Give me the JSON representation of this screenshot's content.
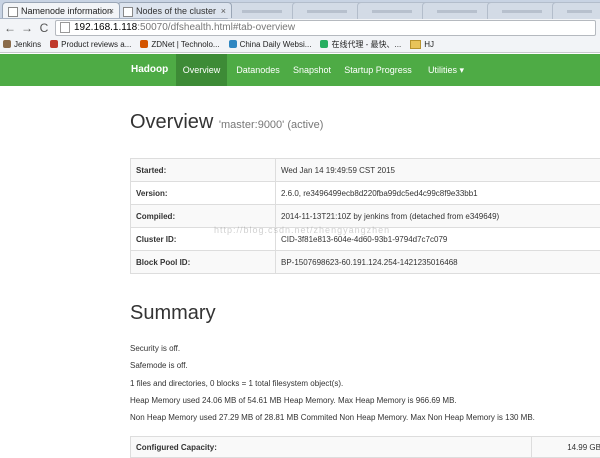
{
  "browser": {
    "tabs": [
      {
        "title": "Namenode information",
        "close": "×"
      },
      {
        "title": "Nodes of the cluster",
        "close": "×"
      }
    ],
    "url": {
      "host": "192.168.1.118",
      "rest": ":50070/dfshealth.html#tab-overview"
    },
    "nav": {
      "back": "←",
      "forward": "→",
      "reload": "C"
    },
    "bookmarks": [
      {
        "label": "Jenkins",
        "color": "#8a6b4a"
      },
      {
        "label": "Product reviews a...",
        "color": "#c0392b"
      },
      {
        "label": "ZDNet | Technolo...",
        "color": "#d35400"
      },
      {
        "label": "China Daily Websi...",
        "color": "#2e86c1"
      },
      {
        "label": "在线代理 - 最快、...",
        "color": "#27ae60"
      },
      {
        "label": "HJ",
        "color": "#e8c35a"
      }
    ]
  },
  "navbar": {
    "brand": "Hadoop",
    "links": [
      "Overview",
      "Datanodes",
      "Snapshot",
      "Startup Progress",
      "Utilities ▾"
    ],
    "active_color": "#3d8b36",
    "bar_color": "#4eab45"
  },
  "overview": {
    "title": "Overview",
    "subtitle": "'master:9000' (active)",
    "rows": [
      {
        "key": "Started:",
        "value": "Wed Jan 14 19:49:59 CST 2015"
      },
      {
        "key": "Version:",
        "value": "2.6.0, re3496499ecb8d220fba99dc5ed4c99c8f9e33bb1"
      },
      {
        "key": "Compiled:",
        "value": "2014-11-13T21:10Z by jenkins from (detached from e349649)"
      },
      {
        "key": "Cluster ID:",
        "value": "CID-3f81e813-604e-4d60-93b1-9794d7c7c079"
      },
      {
        "key": "Block Pool ID:",
        "value": "BP-1507698623-60.191.124.254-1421235016468"
      }
    ]
  },
  "summary": {
    "title": "Summary",
    "lines": [
      "Security is off.",
      "Safemode is off.",
      "1 files and directories, 0 blocks = 1 total filesystem object(s).",
      "Heap Memory used 24.06 MB of 54.61 MB Heap Memory. Max Heap Memory is 966.69 MB.",
      "Non Heap Memory used 27.29 MB of 28.81 MB Commited Non Heap Memory. Max Non Heap Memory is 130 MB."
    ],
    "capacity": {
      "key": "Configured Capacity:",
      "value": "14.99 GB"
    }
  },
  "watermark": "http://blog.csdn.net/zhengyangzhen"
}
